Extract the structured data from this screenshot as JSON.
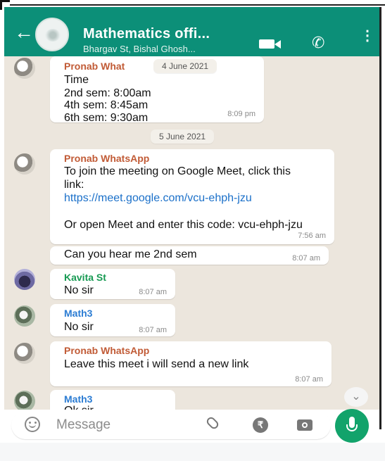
{
  "header": {
    "title": "Mathematics offi...",
    "subtitle": "Bhargav St, Bishal Ghosh..."
  },
  "messages": [
    {
      "sender": "Pronab What",
      "lines": [
        "Time",
        "2nd sem: 8:00am",
        "4th sem: 8:45am",
        "6th sem: 9:30am"
      ],
      "time": "8:09 pm"
    },
    {
      "date": "4 June 2021"
    },
    {
      "date": "5 June 2021"
    },
    {
      "sender": "Pronab WhatsApp",
      "text1": "To join the meeting on Google Meet, click this link:",
      "link": "https://meet.google.com/vcu-ehph-jzu",
      "text2": "Or open Meet and enter this code: vcu-ehph-jzu",
      "time": "7:56 am"
    },
    {
      "text": "Can you hear me 2nd sem",
      "time": "8:07 am"
    },
    {
      "sender": "Kavita St",
      "text": "No sir",
      "time": "8:07 am"
    },
    {
      "sender": "Math3",
      "text": "No sir",
      "time": "8:07 am"
    },
    {
      "sender": "Pronab WhatsApp",
      "text": "Leave this meet i will send a new link",
      "time": "8:07 am"
    },
    {
      "sender": "Math3",
      "text": "Ok sir"
    }
  ],
  "composer": {
    "placeholder": "Message"
  },
  "icons": [
    "back-arrow-icon",
    "group-avatar-icon",
    "video-call-icon",
    "phone-icon",
    "menu-icon",
    "scroll-down-icon",
    "emoji-icon",
    "attach-icon",
    "rupee-icon",
    "camera-icon",
    "mic-icon"
  ],
  "colors": {
    "header": "#0c8f78",
    "chat_bg": "#ece6dd",
    "pronab": "#c15b36",
    "kavita": "#179a53",
    "math3": "#2b7cd3",
    "mic": "#12a36b"
  }
}
